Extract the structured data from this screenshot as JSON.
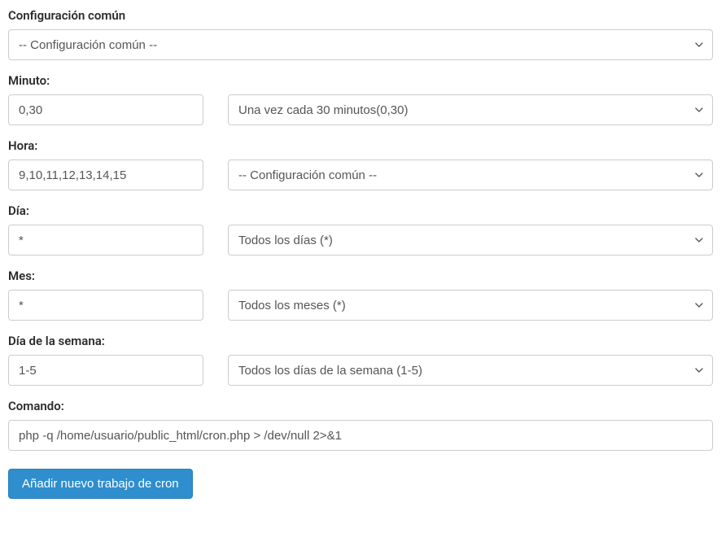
{
  "common_config": {
    "label": "Configuración común",
    "selected": "-- Configuración común --"
  },
  "minute": {
    "label": "Minuto:",
    "value": "0,30",
    "select": "Una vez cada 30 minutos(0,30)"
  },
  "hour": {
    "label": "Hora:",
    "value": "9,10,11,12,13,14,15",
    "select": "-- Configuración común --"
  },
  "day": {
    "label": "Día:",
    "value": "*",
    "select": "Todos los días (*)"
  },
  "month": {
    "label": "Mes:",
    "value": "*",
    "select": "Todos los meses (*)"
  },
  "weekday": {
    "label": "Día de la semana:",
    "value": "1-5",
    "select": "Todos los días de la semana (1-5)"
  },
  "command": {
    "label": "Comando:",
    "value": "php -q /home/usuario/public_html/cron.php > /dev/null 2>&1"
  },
  "submit": {
    "label": "Añadir nuevo trabajo de cron"
  }
}
